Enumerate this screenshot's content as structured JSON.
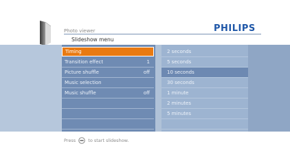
{
  "header": {
    "app_title": "Photo viewer",
    "brand": "PHILIPS",
    "menu_title": "Slideshow menu"
  },
  "menu": {
    "items": [
      {
        "label": "Timing",
        "value": "",
        "selected": true
      },
      {
        "label": "Transition effect",
        "value": "1",
        "selected": false
      },
      {
        "label": "Picture shuffle",
        "value": "off",
        "selected": false
      },
      {
        "label": "Music selection",
        "value": "",
        "selected": false
      },
      {
        "label": "Music shuffle",
        "value": "off",
        "selected": false
      }
    ]
  },
  "values": {
    "items": [
      {
        "label": "2 seconds",
        "current": false
      },
      {
        "label": "5 seconds",
        "current": false
      },
      {
        "label": "10 seconds",
        "current": true
      },
      {
        "label": "30 seconds",
        "current": false
      },
      {
        "label": "1 minute",
        "current": false
      },
      {
        "label": "2 minutes",
        "current": false
      },
      {
        "label": "5 minutes",
        "current": false
      }
    ]
  },
  "footer": {
    "hint_prefix": "Press",
    "hint_suffix": "to start slideshow.",
    "button_icon": "ok-button-icon"
  },
  "colors": {
    "brand": "#1f57a8",
    "highlight": "#e97a12",
    "panel": "#6f8bb3"
  }
}
